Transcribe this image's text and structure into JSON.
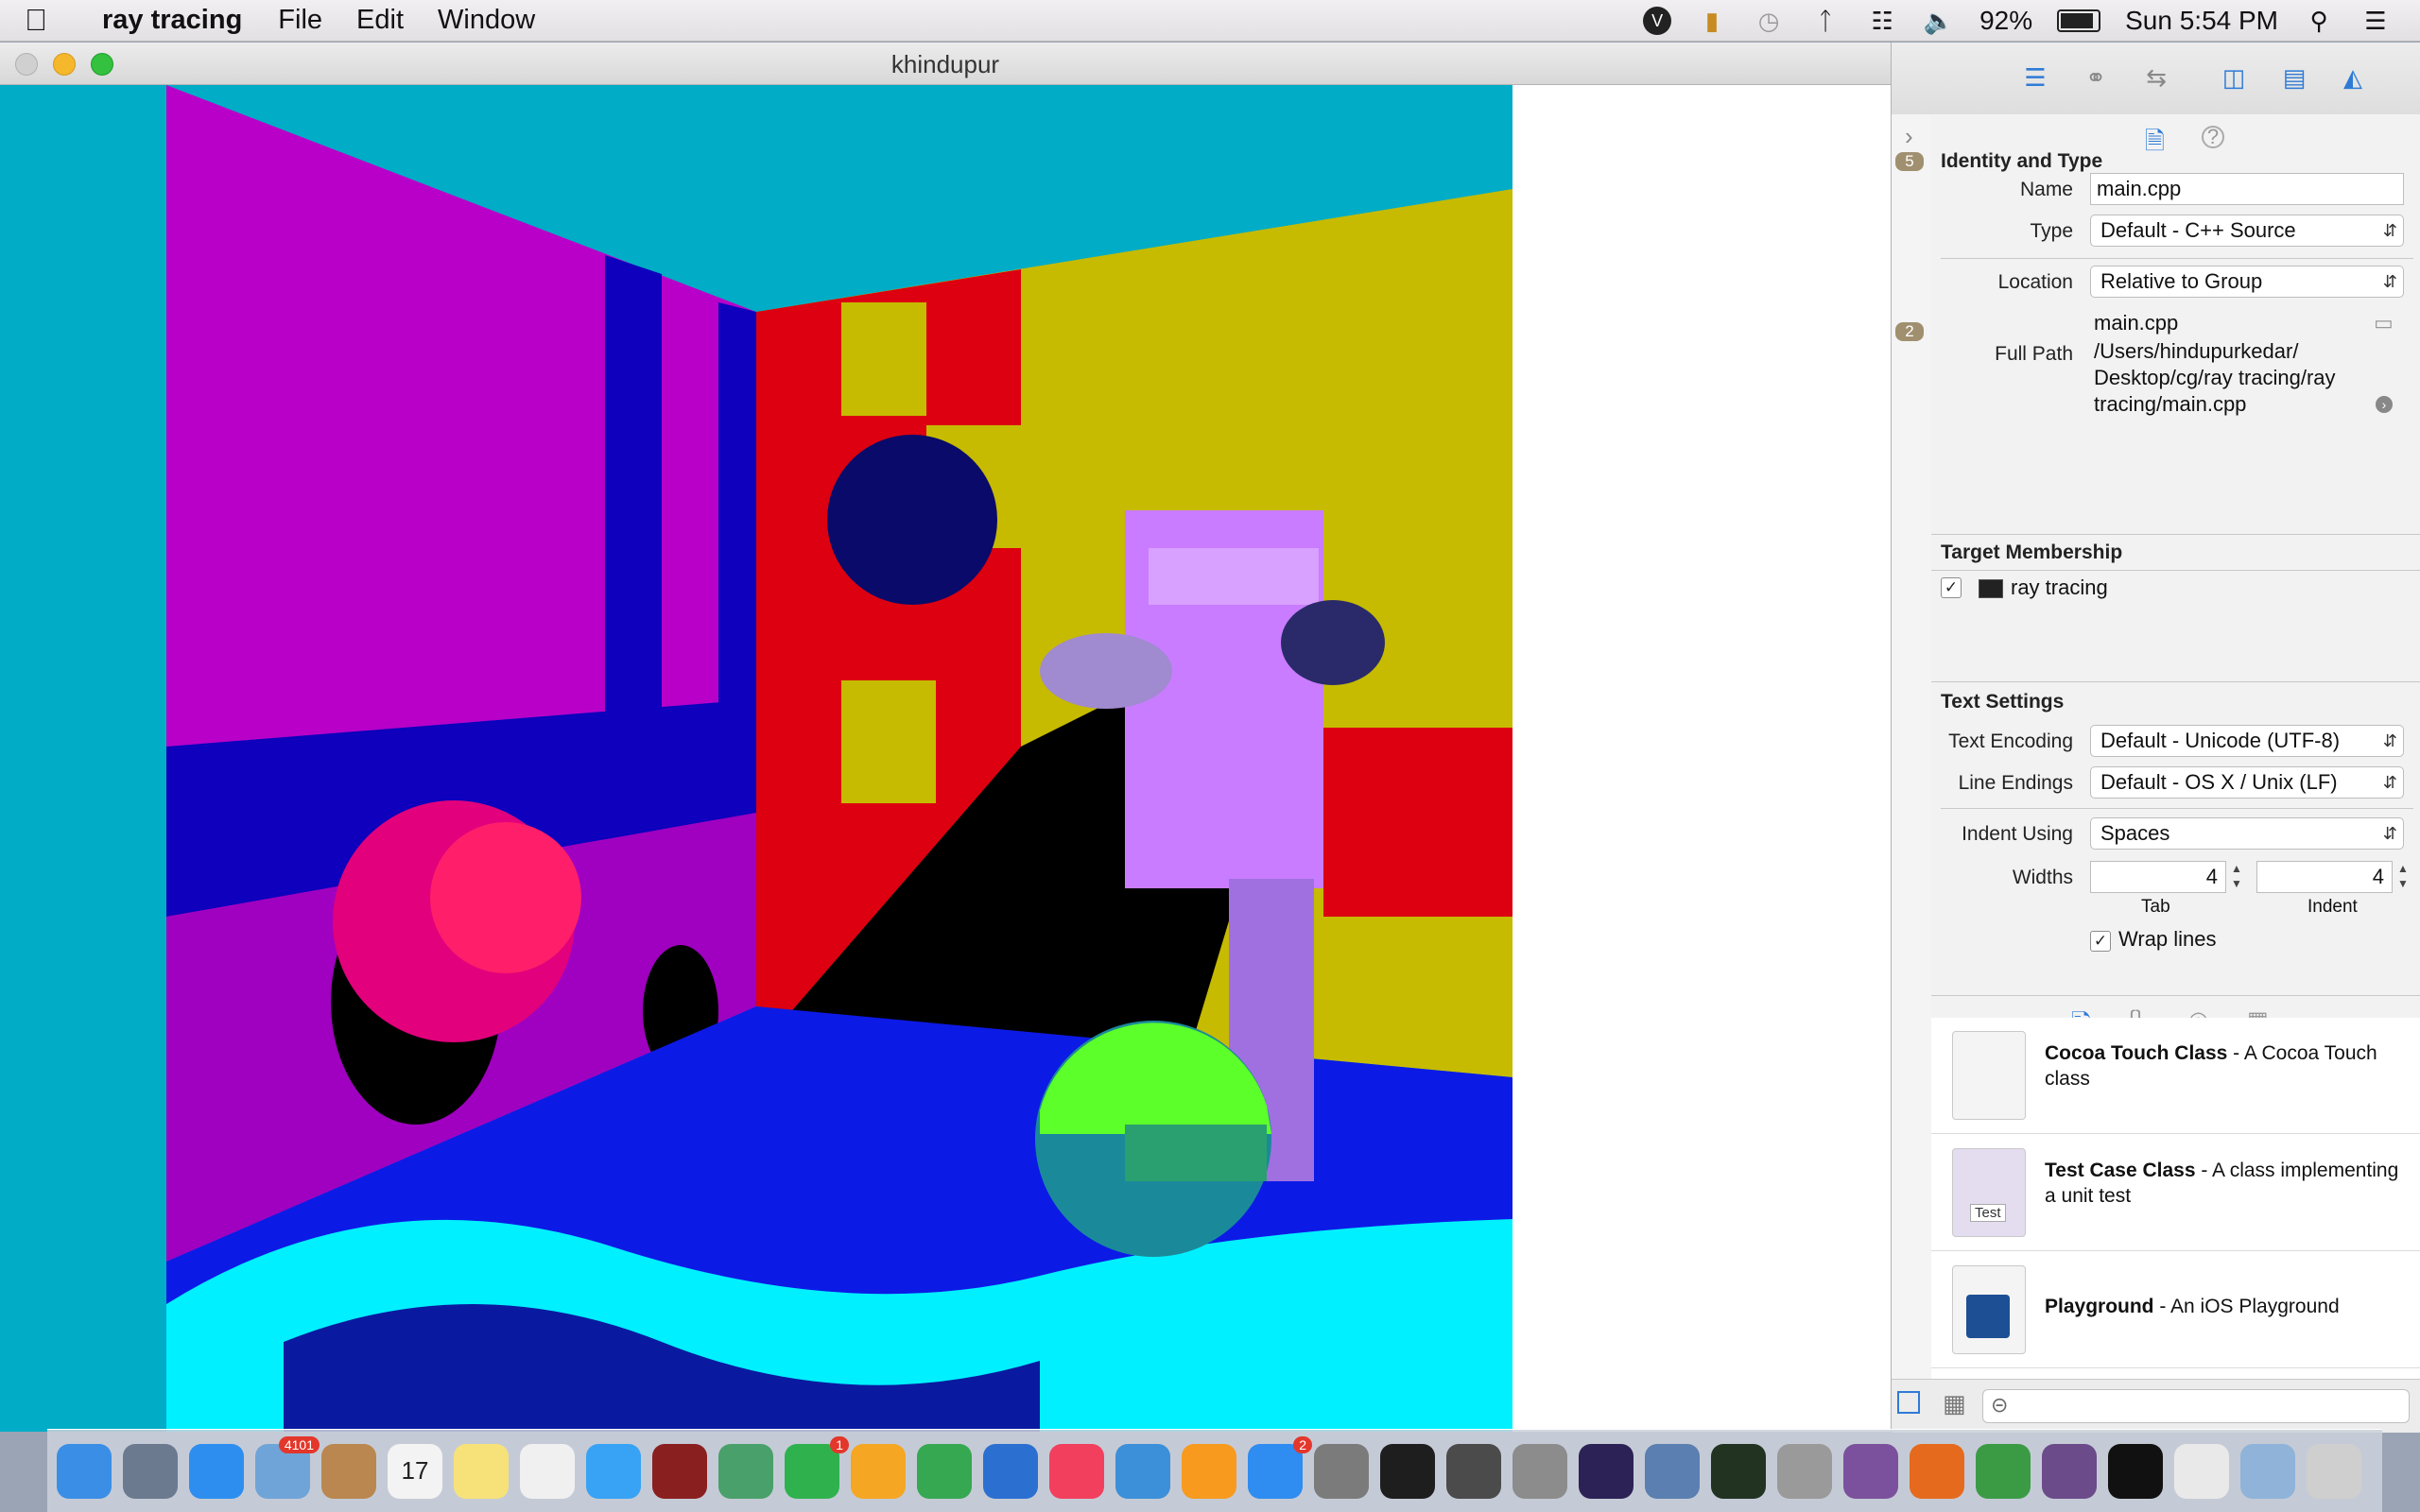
{
  "menubar": {
    "app_name": "ray tracing",
    "items": [
      "File",
      "Edit",
      "Window"
    ],
    "battery": "92%",
    "clock": "Sun 5:54 PM",
    "status_icons": [
      "viber-icon",
      "shield-icon",
      "time-machine-icon",
      "bluetooth-icon",
      "wifi-icon",
      "volume-icon",
      "battery-icon",
      "spotlight-icon",
      "notification-center-icon"
    ]
  },
  "window": {
    "title": "khindupur"
  },
  "navigator": {
    "badges": [
      "5",
      "2"
    ]
  },
  "inspector": {
    "identity_header": "Identity and Type",
    "name_label": "Name",
    "name_value": "main.cpp",
    "type_label": "Type",
    "type_value": "Default - C++ Source",
    "location_label": "Location",
    "location_value": "Relative to Group",
    "location_file": "main.cpp",
    "fullpath_label": "Full Path",
    "fullpath_lines": [
      "/Users/hindupurkedar/",
      "Desktop/cg/ray tracing/ray",
      "tracing/main.cpp"
    ],
    "target_header": "Target Membership",
    "target_name": "ray tracing",
    "target_checked": true,
    "text_header": "Text Settings",
    "encoding_label": "Text Encoding",
    "encoding_value": "Default - Unicode (UTF-8)",
    "line_endings_label": "Line Endings",
    "line_endings_value": "Default - OS X / Unix (LF)",
    "indent_using_label": "Indent Using",
    "indent_using_value": "Spaces",
    "widths_label": "Widths",
    "tab_value": "4",
    "indent_value": "4",
    "tab_caption": "Tab",
    "indent_caption": "Indent",
    "wrap_label": "Wrap lines",
    "wrap_checked": true
  },
  "library": {
    "items": [
      {
        "title": "Cocoa Touch Class",
        "desc": " - A Cocoa Touch class"
      },
      {
        "title": "Test Case Class",
        "desc": " - A class implementing a unit test",
        "icon_text": "Test"
      },
      {
        "title": "Playground",
        "desc": " - An iOS Playground"
      }
    ]
  },
  "dock": {
    "apps": [
      {
        "name": "finder-icon",
        "color": "#3a8ee6"
      },
      {
        "name": "launchpad-icon",
        "color": "#6b7a8f"
      },
      {
        "name": "safari-icon",
        "color": "#2d8ef0"
      },
      {
        "name": "mail-icon",
        "color": "#6fa4d8",
        "badge": "4101"
      },
      {
        "name": "contacts-icon",
        "color": "#b9874f"
      },
      {
        "name": "calendar-icon",
        "color": "#f3f3f3",
        "label": "17"
      },
      {
        "name": "notes-icon",
        "color": "#f7e27a"
      },
      {
        "name": "reminders-icon",
        "color": "#f0f0f0"
      },
      {
        "name": "messages-icon",
        "color": "#38a3f5"
      },
      {
        "name": "photo-booth-icon",
        "color": "#8a1f1f"
      },
      {
        "name": "photos-icon",
        "color": "#4aa06a"
      },
      {
        "name": "facetime-icon",
        "color": "#2fb24e",
        "badge": "1"
      },
      {
        "name": "pages-icon",
        "color": "#f5a623"
      },
      {
        "name": "numbers-icon",
        "color": "#36a852"
      },
      {
        "name": "keynote-icon",
        "color": "#2b6fd1"
      },
      {
        "name": "itunes-icon",
        "color": "#f23f5e"
      },
      {
        "name": "xcode-icon",
        "color": "#3c8fd9"
      },
      {
        "name": "ibooks-icon",
        "color": "#f79a1e"
      },
      {
        "name": "app-store-icon",
        "color": "#2f8cf0",
        "badge": "2"
      },
      {
        "name": "system-preferences-icon",
        "color": "#7b7b7b"
      },
      {
        "name": "terminal-icon",
        "color": "#1e1e1e"
      },
      {
        "name": "sublime-icon",
        "color": "#4b4b4b"
      },
      {
        "name": "utilities-icon",
        "color": "#8c8c8c"
      },
      {
        "name": "eclipse-icon",
        "color": "#2c2255"
      },
      {
        "name": "preview-icon",
        "color": "#5a7fb0"
      },
      {
        "name": "activity-monitor-icon",
        "color": "#223322"
      },
      {
        "name": "image-capture-icon",
        "color": "#9a9a9a"
      },
      {
        "name": "viber-icon",
        "color": "#7b519d"
      },
      {
        "name": "firefox-icon",
        "color": "#e66a1d"
      },
      {
        "name": "chrome-icon",
        "color": "#3b9b45"
      },
      {
        "name": "github-icon",
        "color": "#6b4b8a"
      },
      {
        "name": "exec-icon",
        "color": "#111111"
      },
      {
        "name": "document-icon",
        "color": "#e9e9e9"
      },
      {
        "name": "folder-icon",
        "color": "#8fb3d9"
      },
      {
        "name": "trash-icon",
        "color": "#cfcfcf"
      }
    ]
  },
  "colors": {
    "xcode_accent": "#2e7bd6"
  }
}
